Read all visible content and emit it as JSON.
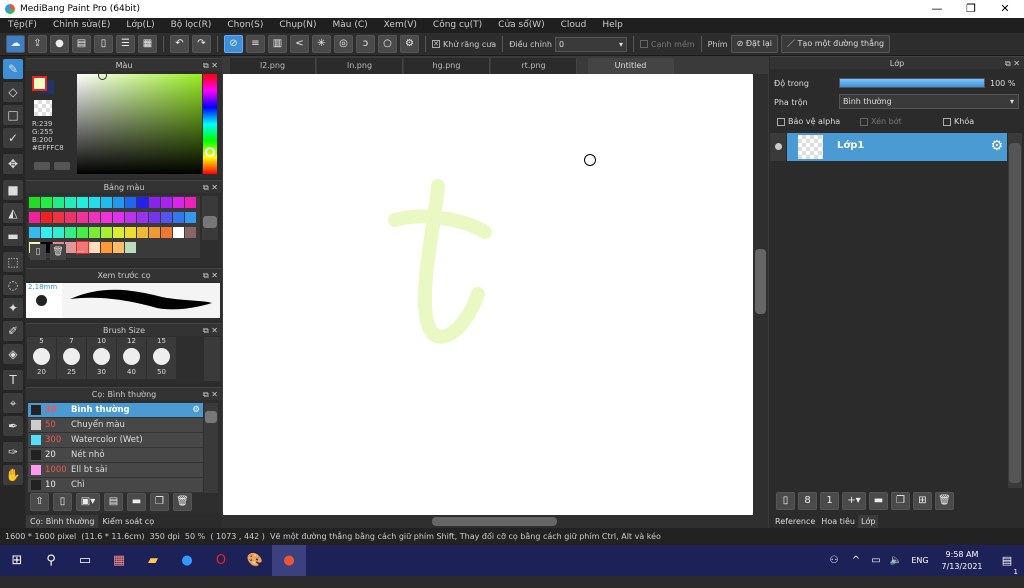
{
  "window": {
    "title": "MediBang Paint Pro (64bit)",
    "min": "—",
    "max": "❐",
    "close": "✕"
  },
  "menu": [
    "Tệp(F)",
    "Chỉnh sửa(E)",
    "Lớp(L)",
    "Bộ lọc(R)",
    "Chọn(S)",
    "Chụp(N)",
    "Màu (C)",
    "Xem(V)",
    "Công cụ(T)",
    "Cửa sổ(W)",
    "Cloud",
    "Help"
  ],
  "toolbar": {
    "antialias": "Khử răng cưa",
    "correction_label": "Điều chỉnh",
    "correction_value": "0",
    "soften": "Cạnh mềm",
    "keys_label": "Phím",
    "reset": "Đặt lại",
    "straight_line": "Tạo một đường thẳng"
  },
  "tabs": [
    "l2.png",
    "ln.png",
    "hg.png",
    "rt.png",
    "Untitled"
  ],
  "color_panel": {
    "title": "Màu",
    "r": "R:239",
    "g": "G:255",
    "b": "B:200",
    "hex": "#EFFFC8",
    "foreground": "#EFFFC8",
    "background": "#223366"
  },
  "palette_panel": {
    "title": "Bảng màu",
    "name": "---",
    "swatches": [
      "#22dd22",
      "#22ee44",
      "#22ee88",
      "#22eebb",
      "#22eedd",
      "#22ddee",
      "#22bbee",
      "#2299ee",
      "#2266ee",
      "#2222ee",
      "#8822ee",
      "#aa22ee",
      "#dd22ee",
      "#ee22bb",
      "#ee2299",
      "#ee2222",
      "#ee3344",
      "#ee3366",
      "#ee3399",
      "#ee33bb",
      "#ee33dd",
      "#dd33ee",
      "#bb33ee",
      "#9933ee",
      "#7733ee",
      "#5555ee",
      "#3377ee",
      "#3399ee",
      "#33bbee",
      "#33eeee",
      "#33eecc",
      "#33ee88",
      "#44ee44",
      "#77ee33",
      "#aaee33",
      "#ddee33",
      "#eedd33",
      "#eebb33",
      "#ee9933",
      "#ee7733",
      "#ffffff",
      "#886666",
      "#eeffaa",
      "#000000",
      "#ee8888",
      "#dd9999",
      "#ee7777",
      "#ffddbb",
      "#ff9933",
      "#ffbb66",
      "#bbddbb"
    ]
  },
  "brush_preview": {
    "title": "Xem trước cọ",
    "size": "2.18mm"
  },
  "brush_size": {
    "title": "Brush Size",
    "top": [
      "5",
      "7",
      "10",
      "12",
      "15"
    ],
    "bottom": [
      "20",
      "25",
      "30",
      "40",
      "50"
    ]
  },
  "brush_list": {
    "title": "Cọ: Bình thường",
    "items": [
      {
        "size": "30",
        "name": "Bình thường",
        "color": "#222222"
      },
      {
        "size": "50",
        "name": "Chuyển màu",
        "color": "#cccccc"
      },
      {
        "size": "300",
        "name": "Watercolor (Wet)",
        "color": "#55ddff"
      },
      {
        "size": "20",
        "name": "Nét nhỏ",
        "color": "#222222"
      },
      {
        "size": "1000",
        "name": "Ell bt sài",
        "color": "#ff99ee"
      },
      {
        "size": "10",
        "name": "Chì",
        "color": "#222222"
      }
    ]
  },
  "left_bottom_tabs": [
    "Cọ: Bình thường",
    "Kiểm soát cọ"
  ],
  "layer_panel": {
    "title": "Lớp",
    "opacity_label": "Độ trong",
    "opacity_value": "100 %",
    "opacity": 1.0,
    "blend_label": "Pha trộn",
    "blend_value": "Bình thường",
    "protect_alpha": "Bảo vệ alpha",
    "clipping": "Xén bớt",
    "lock": "Khóa",
    "layers": [
      {
        "name": "Lớp1"
      }
    ]
  },
  "right_bottom_tabs": [
    "Reference",
    "Hoa tiêu",
    "Lớp"
  ],
  "status": {
    "size": "1600 * 1600 pixel",
    "cm": "(11.6 * 11.6cm)",
    "dpi": "350 dpi",
    "zoom": "50 %",
    "coords": "( 1073 , 442 )",
    "hint": "Vẽ một đường thẳng bằng cách giữ phím Shift, Thay đổi cỡ cọ bằng cách giữ phím Ctrl, Alt và kéo"
  },
  "taskbar": {
    "lang": "ENG",
    "time": "9:58 AM",
    "date": "7/13/2021",
    "notif": "1"
  }
}
